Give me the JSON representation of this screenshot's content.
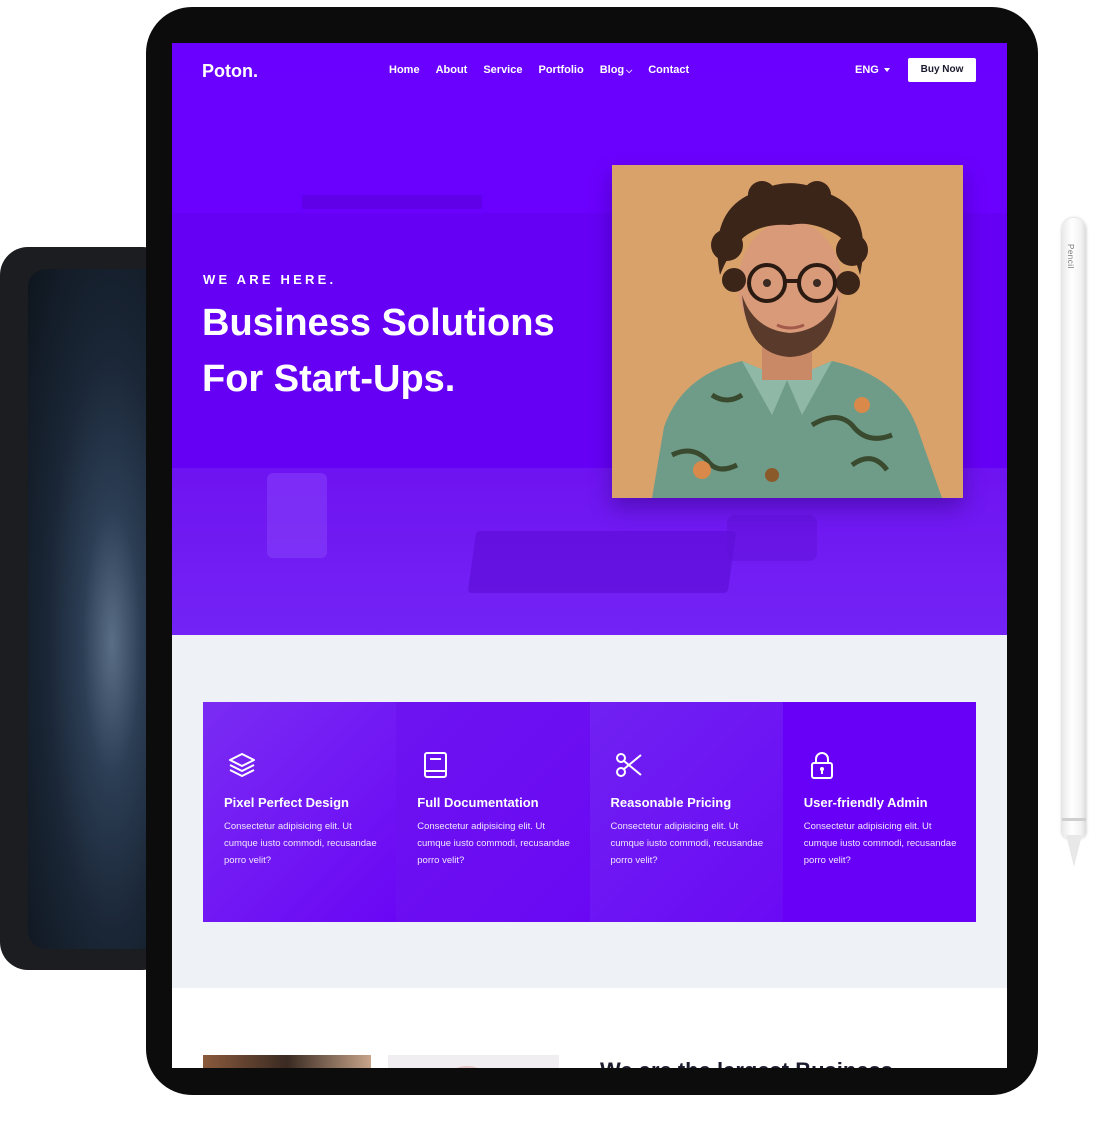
{
  "nav": {
    "logo": "Poton.",
    "items": [
      {
        "label": "Home"
      },
      {
        "label": "About"
      },
      {
        "label": "Service"
      },
      {
        "label": "Portfolio"
      },
      {
        "label": "Blog"
      },
      {
        "label": "Contact"
      }
    ],
    "blog_caret": "⌵",
    "language": "ENG",
    "cta": "Buy Now"
  },
  "hero": {
    "eyebrow": "WE ARE HERE.",
    "headline_line1": "Business Solutions",
    "headline_line2": "For Start-Ups."
  },
  "features": [
    {
      "icon": "layers-icon",
      "title": "Pixel Perfect Design",
      "desc": "Consectetur adipisicing elit. Ut cumque iusto commodi, recusandae porro velit?"
    },
    {
      "icon": "book-icon",
      "title": "Full Documentation",
      "desc": "Consectetur adipisicing elit. Ut cumque iusto commodi, recusandae porro velit?"
    },
    {
      "icon": "scissors-icon",
      "title": "Reasonable Pricing",
      "desc": "Consectetur adipisicing elit. Ut cumque iusto commodi, recusandae porro velit?"
    },
    {
      "icon": "lock-icon",
      "title": "User-friendly Admin",
      "desc": "Consectetur adipisicing elit. Ut cumque iusto commodi, recusandae porro velit?"
    }
  ],
  "bottom": {
    "heading": "We are the largest Business"
  },
  "pencil": {
    "label": "Pencil"
  },
  "colors": {
    "brand_purple": "#6a00ff",
    "light_bg": "#eef1f6",
    "device_frame": "#0c0c0d"
  }
}
